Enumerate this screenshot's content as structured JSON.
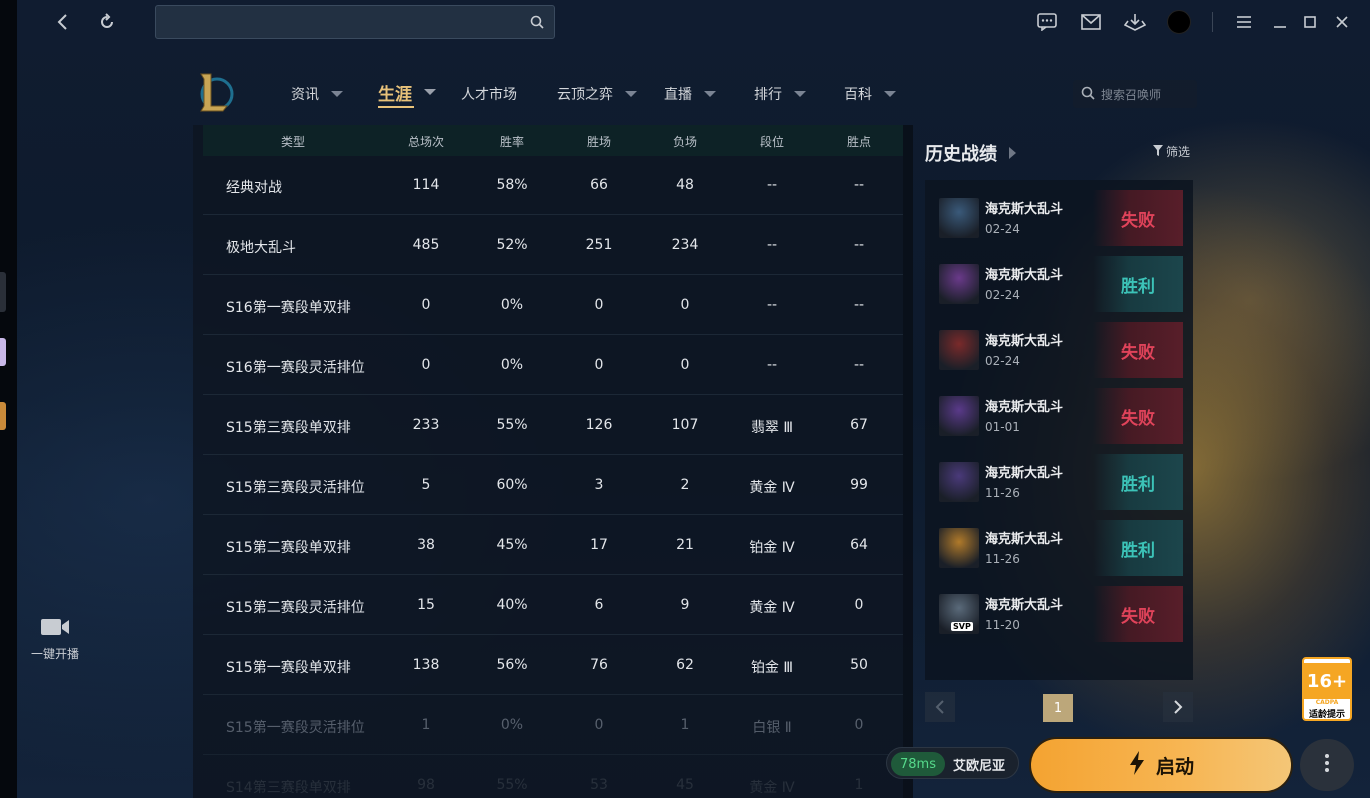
{
  "topbar": {
    "search_placeholder": ""
  },
  "nav": {
    "items": [
      {
        "label": "资讯",
        "caret": true
      },
      {
        "label": "生涯",
        "caret": true,
        "active": true
      },
      {
        "label": "人才市场",
        "caret": false
      },
      {
        "label": "云顶之弈",
        "caret": true
      },
      {
        "label": "直播",
        "caret": true
      },
      {
        "label": "排行",
        "caret": true
      },
      {
        "label": "百科",
        "caret": true
      }
    ],
    "summoner_search_placeholder": "搜索召唤师"
  },
  "stats_table": {
    "headers": [
      "类型",
      "总场次",
      "胜率",
      "胜场",
      "负场",
      "段位",
      "胜点"
    ],
    "rows": [
      [
        "经典对战",
        "114",
        "58%",
        "66",
        "48",
        "--",
        "--"
      ],
      [
        "极地大乱斗",
        "485",
        "52%",
        "251",
        "234",
        "--",
        "--"
      ],
      [
        "S16第一赛段单双排",
        "0",
        "0%",
        "0",
        "0",
        "--",
        "--"
      ],
      [
        "S16第一赛段灵活排位",
        "0",
        "0%",
        "0",
        "0",
        "--",
        "--"
      ],
      [
        "S15第三赛段单双排",
        "233",
        "55%",
        "126",
        "107",
        "翡翠 Ⅲ",
        "67"
      ],
      [
        "S15第三赛段灵活排位",
        "5",
        "60%",
        "3",
        "2",
        "黄金 Ⅳ",
        "99"
      ],
      [
        "S15第二赛段单双排",
        "38",
        "45%",
        "17",
        "21",
        "铂金 Ⅳ",
        "64"
      ],
      [
        "S15第二赛段灵活排位",
        "15",
        "40%",
        "6",
        "9",
        "黄金 Ⅳ",
        "0"
      ],
      [
        "S15第一赛段单双排",
        "138",
        "56%",
        "76",
        "62",
        "铂金 Ⅲ",
        "50"
      ],
      [
        "S15第一赛段灵活排位",
        "1",
        "0%",
        "0",
        "1",
        "白银 Ⅱ",
        "0"
      ],
      [
        "S14第三赛段单双排",
        "98",
        "55%",
        "53",
        "45",
        "黄金 Ⅳ",
        "1"
      ]
    ]
  },
  "history": {
    "title": "历史战绩",
    "filter_label": "筛选",
    "matches": [
      {
        "mode": "海克斯大乱斗",
        "date": "02-24",
        "result": "失败",
        "outcome": "lose",
        "color": "#3a5a7a"
      },
      {
        "mode": "海克斯大乱斗",
        "date": "02-24",
        "result": "胜利",
        "outcome": "win",
        "color": "#6a3a8a"
      },
      {
        "mode": "海克斯大乱斗",
        "date": "02-24",
        "result": "失败",
        "outcome": "lose",
        "color": "#7a2a2a"
      },
      {
        "mode": "海克斯大乱斗",
        "date": "01-01",
        "result": "失败",
        "outcome": "lose",
        "color": "#5a3a8a"
      },
      {
        "mode": "海克斯大乱斗",
        "date": "11-26",
        "result": "胜利",
        "outcome": "win",
        "color": "#4a3a7a"
      },
      {
        "mode": "海克斯大乱斗",
        "date": "11-26",
        "result": "胜利",
        "outcome": "win",
        "color": "#b07a2a"
      },
      {
        "mode": "海克斯大乱斗",
        "date": "11-20",
        "result": "失败",
        "outcome": "lose",
        "color": "#5a6a7a",
        "badge": "SVP"
      }
    ],
    "pager": {
      "current_page": "1"
    }
  },
  "bottom": {
    "ping": "78ms",
    "server": "艾欧尼亚",
    "launch_label": "启动",
    "live_label": "一键开播",
    "age_rating": "16+",
    "age_org": "CADPA",
    "age_tip": "适龄提示"
  },
  "colors": {
    "accent_gold": "#e8c27a",
    "win": "#3cc3b8",
    "lose": "#e0435a",
    "launch": "#f4a331"
  }
}
